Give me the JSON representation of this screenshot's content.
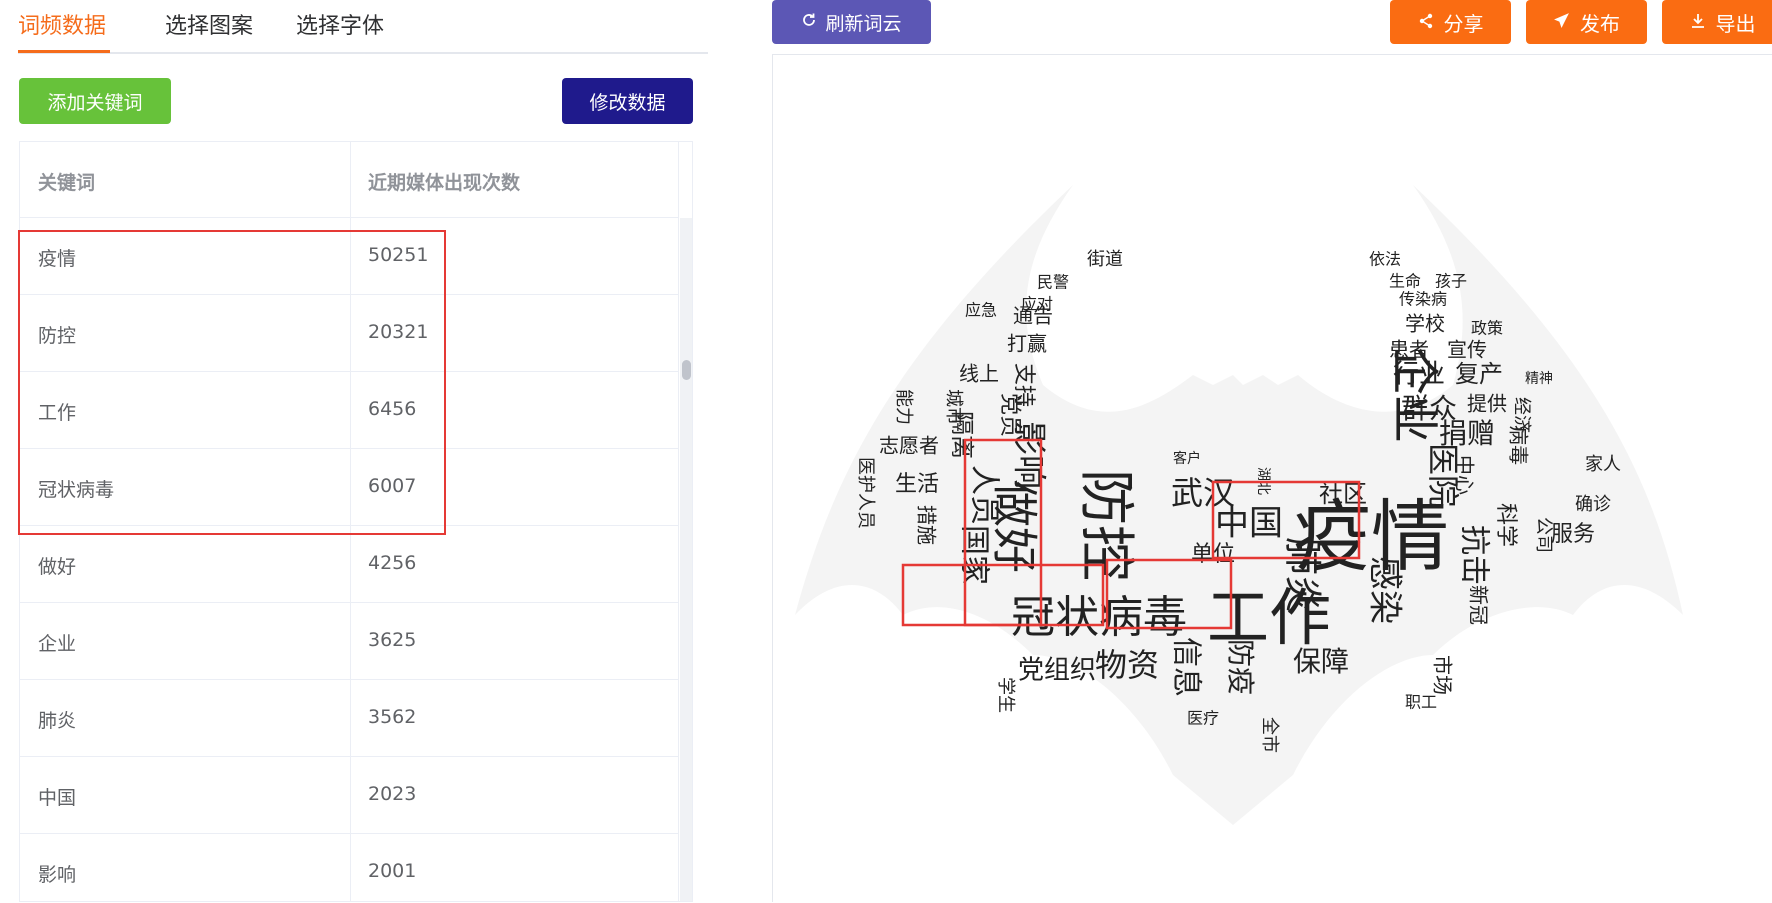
{
  "tabs": [
    {
      "label": "词频数据"
    },
    {
      "label": "选择图案"
    },
    {
      "label": "选择字体"
    }
  ],
  "buttons": {
    "add_keyword": "添加关键词",
    "edit_data": "修改数据",
    "refresh": "刷新词云",
    "share": "分享",
    "publish": "发布",
    "export": "导出"
  },
  "icons": {
    "refresh": "refresh-icon",
    "share": "share-icon",
    "publish": "paper-plane-icon",
    "export": "download-icon"
  },
  "table": {
    "headers": [
      "关键词",
      "近期媒体出现次数"
    ],
    "rows": [
      {
        "keyword": "疫情",
        "count": "50251"
      },
      {
        "keyword": "防控",
        "count": "20321"
      },
      {
        "keyword": "工作",
        "count": "6456"
      },
      {
        "keyword": "冠状病毒",
        "count": "6007"
      },
      {
        "keyword": "做好",
        "count": "4256"
      },
      {
        "keyword": "企业",
        "count": "3625"
      },
      {
        "keyword": "肺炎",
        "count": "3562"
      },
      {
        "keyword": "中国",
        "count": "2023"
      },
      {
        "keyword": "影响",
        "count": "2001"
      }
    ]
  },
  "colors": {
    "tab_active": "#f56c1b",
    "add_button": "#67c23a",
    "edit_button": "#1f1a8c",
    "refresh_button": "#5c57b5",
    "action_button": "#fa6c12",
    "highlight_box": "#e53935"
  },
  "wordcloud": {
    "shape": "bat",
    "words": [
      {
        "text": "疫情",
        "size": 78
      },
      {
        "text": "工作",
        "size": 62
      },
      {
        "text": "防控",
        "size": 56
      },
      {
        "text": "冠状病毒",
        "size": 44
      },
      {
        "text": "做好",
        "size": 46
      },
      {
        "text": "企业",
        "size": 48
      },
      {
        "text": "肺炎",
        "size": 38
      },
      {
        "text": "中国",
        "size": 34
      },
      {
        "text": "影响",
        "size": 34
      },
      {
        "text": "武汉",
        "size": 32
      },
      {
        "text": "国家",
        "size": 30
      },
      {
        "text": "人员",
        "size": 30
      },
      {
        "text": "医院",
        "size": 32
      },
      {
        "text": "感染",
        "size": 34
      },
      {
        "text": "抗击",
        "size": 30
      },
      {
        "text": "物资",
        "size": 32
      },
      {
        "text": "信息",
        "size": 30
      },
      {
        "text": "防疫",
        "size": 28
      },
      {
        "text": "保障",
        "size": 28
      },
      {
        "text": "党组织",
        "size": 26
      },
      {
        "text": "群众",
        "size": 28
      },
      {
        "text": "捐赠",
        "size": 28
      },
      {
        "text": "行业",
        "size": 26
      },
      {
        "text": "复产",
        "size": 24
      },
      {
        "text": "社区",
        "size": 24
      },
      {
        "text": "单位",
        "size": 22
      },
      {
        "text": "科学",
        "size": 22
      },
      {
        "text": "服务",
        "size": 22
      },
      {
        "text": "隔离",
        "size": 24
      },
      {
        "text": "生活",
        "size": 22
      },
      {
        "text": "支持",
        "size": 22
      },
      {
        "text": "党员",
        "size": 22
      },
      {
        "text": "通告",
        "size": 20
      },
      {
        "text": "打赢",
        "size": 20
      },
      {
        "text": "学校",
        "size": 20
      },
      {
        "text": "患者",
        "size": 20
      },
      {
        "text": "宣传",
        "size": 20
      },
      {
        "text": "提供",
        "size": 20
      },
      {
        "text": "志愿者",
        "size": 20
      },
      {
        "text": "措施",
        "size": 20
      },
      {
        "text": "市场",
        "size": 20
      },
      {
        "text": "新冠",
        "size": 20
      },
      {
        "text": "病毒",
        "size": 20
      },
      {
        "text": "家人",
        "size": 18
      },
      {
        "text": "确诊",
        "size": 18
      },
      {
        "text": "公司",
        "size": 18
      },
      {
        "text": "街道",
        "size": 18
      },
      {
        "text": "民警",
        "size": 16
      },
      {
        "text": "应急",
        "size": 16
      },
      {
        "text": "应对",
        "size": 16
      },
      {
        "text": "依法",
        "size": 16
      },
      {
        "text": "孩子",
        "size": 16
      },
      {
        "text": "生命",
        "size": 16
      },
      {
        "text": "传染病",
        "size": 16
      },
      {
        "text": "政策",
        "size": 16
      },
      {
        "text": "精神",
        "size": 14
      },
      {
        "text": "客户",
        "size": 14
      },
      {
        "text": "湖北",
        "size": 14
      },
      {
        "text": "全市",
        "size": 18
      },
      {
        "text": "医疗",
        "size": 16
      },
      {
        "text": "学生",
        "size": 18
      },
      {
        "text": "职工",
        "size": 16
      },
      {
        "text": "线上",
        "size": 20
      },
      {
        "text": "城市",
        "size": 18
      },
      {
        "text": "能力",
        "size": 18
      },
      {
        "text": "医护人员",
        "size": 18
      },
      {
        "text": "中心",
        "size": 20
      },
      {
        "text": "经济",
        "size": 18
      }
    ]
  }
}
